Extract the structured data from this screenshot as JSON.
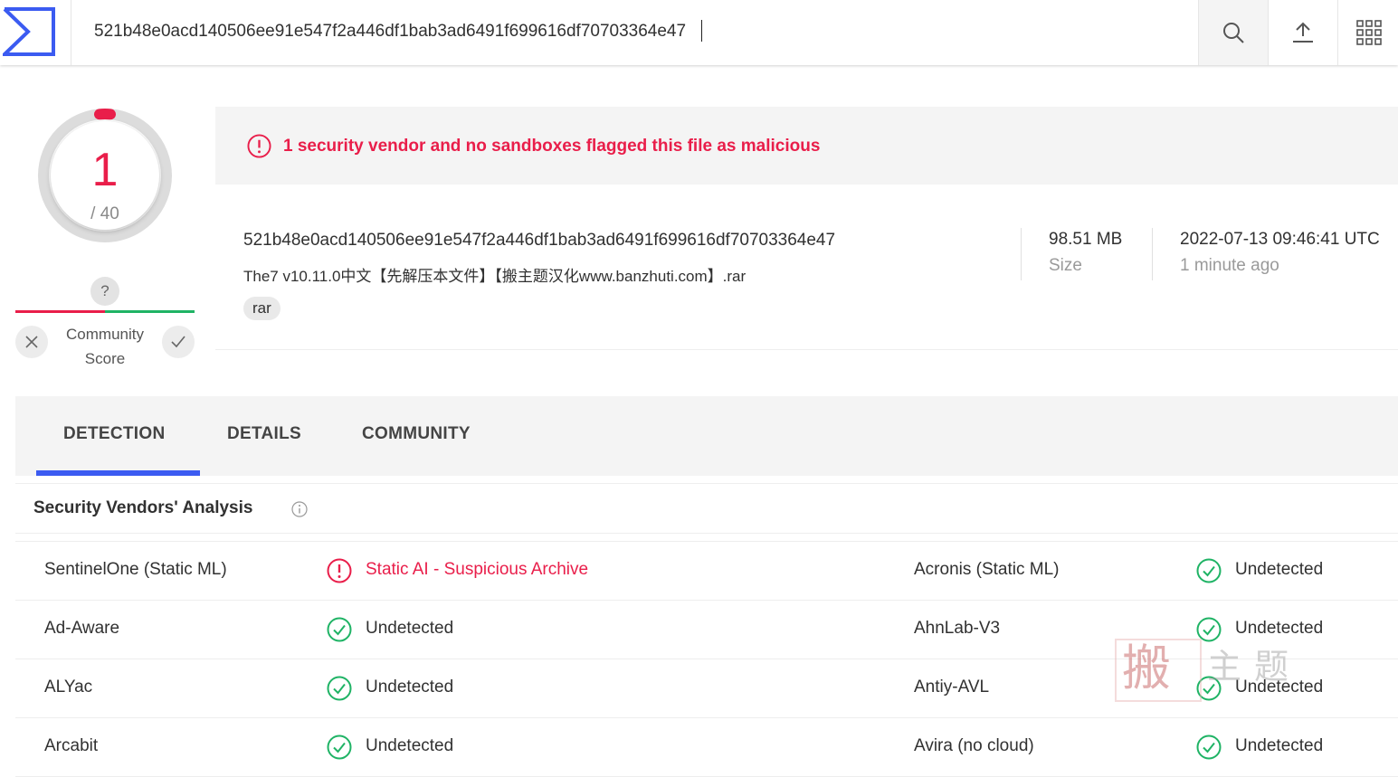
{
  "search": {
    "value": "521b48e0acd140506ee91e547f2a446df1bab3ad6491f699616df70703364e47"
  },
  "score": {
    "detections": "1",
    "total": "/ 40"
  },
  "community": {
    "badge": "?",
    "label_line1": "Community",
    "label_line2": "Score"
  },
  "alert": {
    "text": "1 security vendor and no sandboxes flagged this file as malicious"
  },
  "file": {
    "hash": "521b48e0acd140506ee91e547f2a446df1bab3ad6491f699616df70703364e47",
    "name": "The7 v10.11.0中文【先解压本文件】【搬主题汉化www.banzhuti.com】.rar",
    "tag": "rar",
    "size_value": "98.51 MB",
    "size_label": "Size",
    "date_value": "2022-07-13 09:46:41 UTC",
    "date_label": "1 minute ago"
  },
  "tabs": {
    "detection": "DETECTION",
    "details": "DETAILS",
    "community": "COMMUNITY"
  },
  "vendors": {
    "title": "Security Vendors' Analysis",
    "rows": [
      {
        "left_name": "SentinelOne (Static ML)",
        "left_result": "Static AI - Suspicious Archive",
        "left_status": "malicious",
        "right_name": "Acronis (Static ML)",
        "right_result": "Undetected",
        "right_status": "undetected"
      },
      {
        "left_name": "Ad-Aware",
        "left_result": "Undetected",
        "left_status": "undetected",
        "right_name": "AhnLab-V3",
        "right_result": "Undetected",
        "right_status": "undetected"
      },
      {
        "left_name": "ALYac",
        "left_result": "Undetected",
        "left_status": "undetected",
        "right_name": "Antiy-AVL",
        "right_result": "Undetected",
        "right_status": "undetected"
      },
      {
        "left_name": "Arcabit",
        "left_result": "Undetected",
        "left_status": "undetected",
        "right_name": "Avira (no cloud)",
        "right_result": "Undetected",
        "right_status": "undetected"
      }
    ]
  },
  "watermark": {
    "main": "搬",
    "sub": "主题"
  },
  "colors": {
    "malicious": "#e91e4a",
    "clean": "#1fb365",
    "accent": "#3b5bf1"
  }
}
